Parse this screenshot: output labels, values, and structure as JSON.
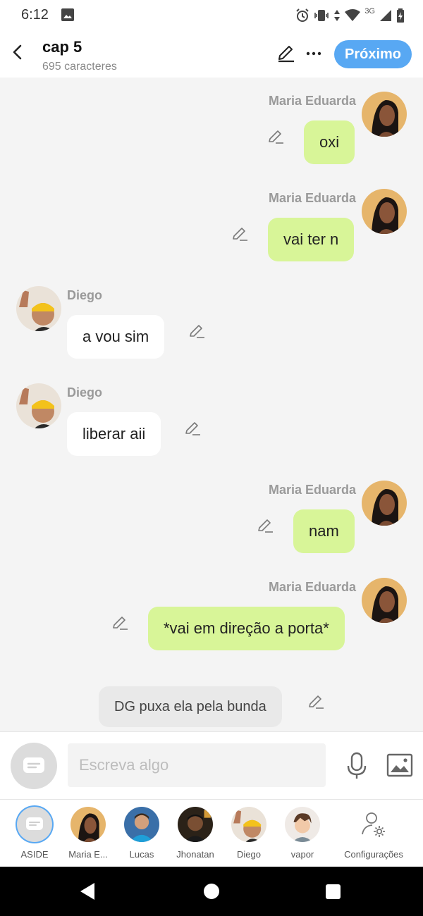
{
  "status": {
    "time": "6:12",
    "network": "3G"
  },
  "header": {
    "title": "cap 5",
    "subtitle": "695 caracteres",
    "next_label": "Próximo",
    "accent": "#58a8f3"
  },
  "messages": [
    {
      "author": "Maria Eduarda",
      "text": "oxi",
      "side": "right"
    },
    {
      "author": "Maria Eduarda",
      "text": "vai ter n",
      "side": "right"
    },
    {
      "author": "Diego",
      "text": "a vou sim",
      "side": "left"
    },
    {
      "author": "Diego",
      "text": "liberar aii",
      "side": "left"
    },
    {
      "author": "Maria Eduarda",
      "text": "nam",
      "side": "right"
    },
    {
      "author": "Maria Eduarda",
      "text": "*vai em direção a porta*",
      "side": "right"
    },
    {
      "author": "",
      "text": "DG puxa ela pela bunda",
      "side": "narration"
    }
  ],
  "composer": {
    "placeholder": "Escreva algo"
  },
  "characters": [
    {
      "label": "ASIDE"
    },
    {
      "label": "Maria E..."
    },
    {
      "label": "Lucas"
    },
    {
      "label": "Jhonatan"
    },
    {
      "label": "Diego"
    },
    {
      "label": "vapor"
    },
    {
      "label": "Configurações"
    }
  ],
  "colors": {
    "my_bubble": "#d8f598",
    "other_bubble": "#ffffff",
    "narration_bubble": "#e9e9e9",
    "chat_bg": "#f4f4f4"
  }
}
